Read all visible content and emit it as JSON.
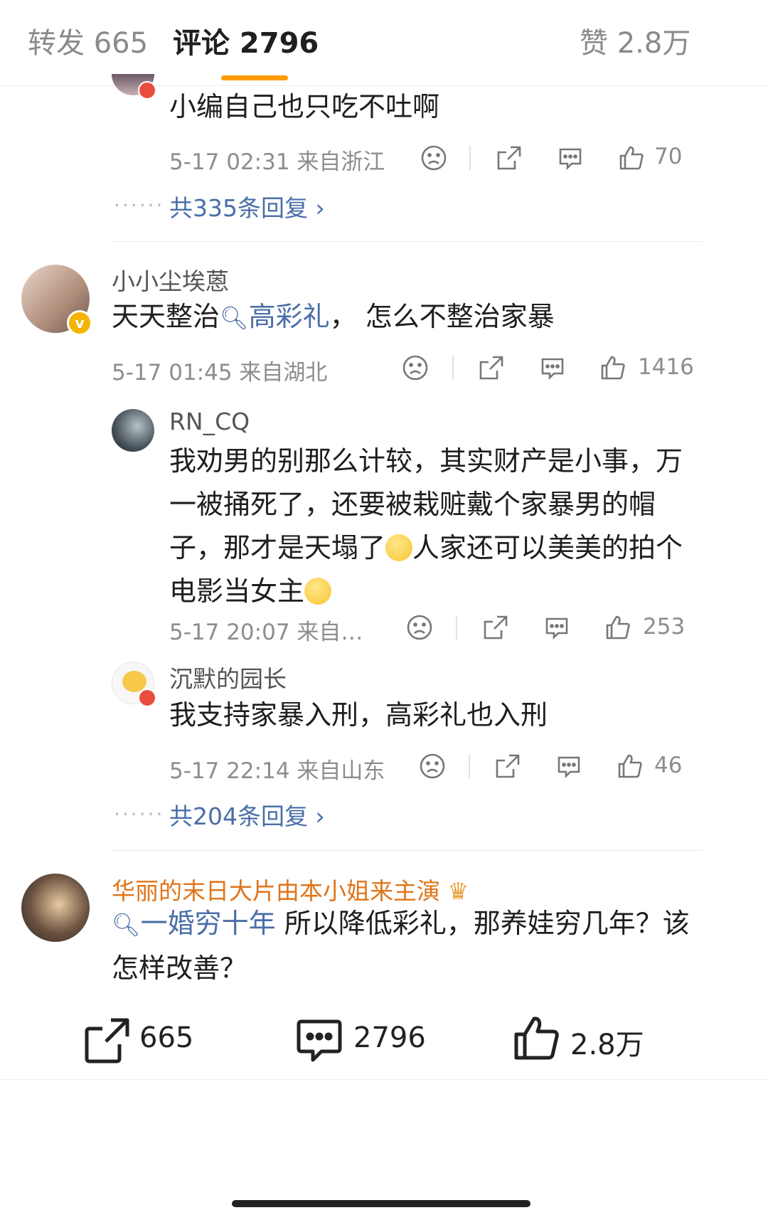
{
  "tabs": {
    "repost": "转发 665",
    "comments": "评论 2796",
    "likes": "赞 2.8万"
  },
  "comment0": {
    "text": "小编自己也只吃不吐啊",
    "time_location": "5-17 02:31  来自浙江",
    "likes": "70",
    "more_replies": "共335条回复"
  },
  "comment1": {
    "username": "小小尘埃蒽",
    "text_prefix": "天天整治",
    "topic": "高彩礼",
    "text_suffix": "，  怎么不整治家暴",
    "time_location": "5-17 01:45  来自湖北",
    "likes": "1416",
    "replies": [
      {
        "username": "RN_CQ",
        "text_a": "我劝男的别那么计较，其实财产是小事，万一被捅死了，还要被栽赃戴个家暴男的帽子，那才是天塌了",
        "text_b": "人家还可以美美的拍个电影当女主",
        "time_location": "5-17 20:07  来自…",
        "likes": "253"
      },
      {
        "username": "沉默的园长",
        "text": "我支持家暴入刑，高彩礼也入刑",
        "time_location": "5-17 22:14  来自山东",
        "likes": "46"
      }
    ],
    "more_replies": "共204条回复"
  },
  "comment2": {
    "username": "华丽的末日大片由本小姐来主演",
    "topic": "一婚穷十年",
    "text": " 所以降低彩礼，那养娃穷几年？该怎样改善？"
  },
  "bottom_bar": {
    "repost": "665",
    "comments": "2796",
    "likes": "2.8万"
  },
  "icons": [
    "dislike-icon",
    "share-icon",
    "comment-icon",
    "like-icon",
    "search-topic-icon",
    "verified-badge-icon",
    "crown-badge-icon",
    "chevron-right-icon"
  ],
  "colors": {
    "accent": "#ff9a00",
    "link": "#4a6ea8",
    "username_vip": "#e0741a"
  }
}
